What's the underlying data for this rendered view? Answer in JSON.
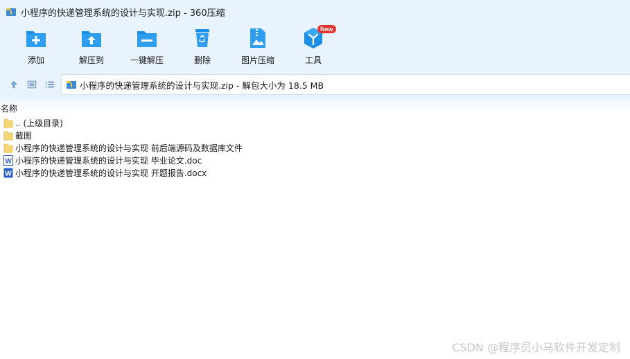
{
  "window": {
    "title": "小程序的快递管理系统的设计与实现.zip - 360压缩"
  },
  "toolbar": {
    "add_label": "添加",
    "extract_to_label": "解压到",
    "one_click_extract_label": "一键解压",
    "delete_label": "删除",
    "image_compress_label": "图片压缩",
    "tools_label": "工具",
    "tools_badge": "New"
  },
  "address": {
    "path": "小程序的快递管理系统的设计与实现.zip - 解包大小为 18.5 MB"
  },
  "columns": {
    "name": "名称"
  },
  "files": [
    {
      "label": ".. (上级目录)",
      "icon": "folder-icon"
    },
    {
      "label": "截图",
      "icon": "folder-icon"
    },
    {
      "label": "小程序的快递管理系统的设计与实现 前后端源码及数据库文件",
      "icon": "folder-icon"
    },
    {
      "label": "小程序的快递管理系统的设计与实现 毕业论文.doc",
      "icon": "word-doc-icon"
    },
    {
      "label": "小程序的快递管理系统的设计与实现 开题报告.docx",
      "icon": "word-docx-icon"
    }
  ],
  "watermark": "CSDN @程序员小马软件开发定制",
  "colors": {
    "chrome_bg": "#e9f3fd",
    "icon_blue": "#1a8fe8",
    "folder_yellow": "#f7d774",
    "badge_red": "#e5312b",
    "word_blue": "#2b62c8"
  }
}
